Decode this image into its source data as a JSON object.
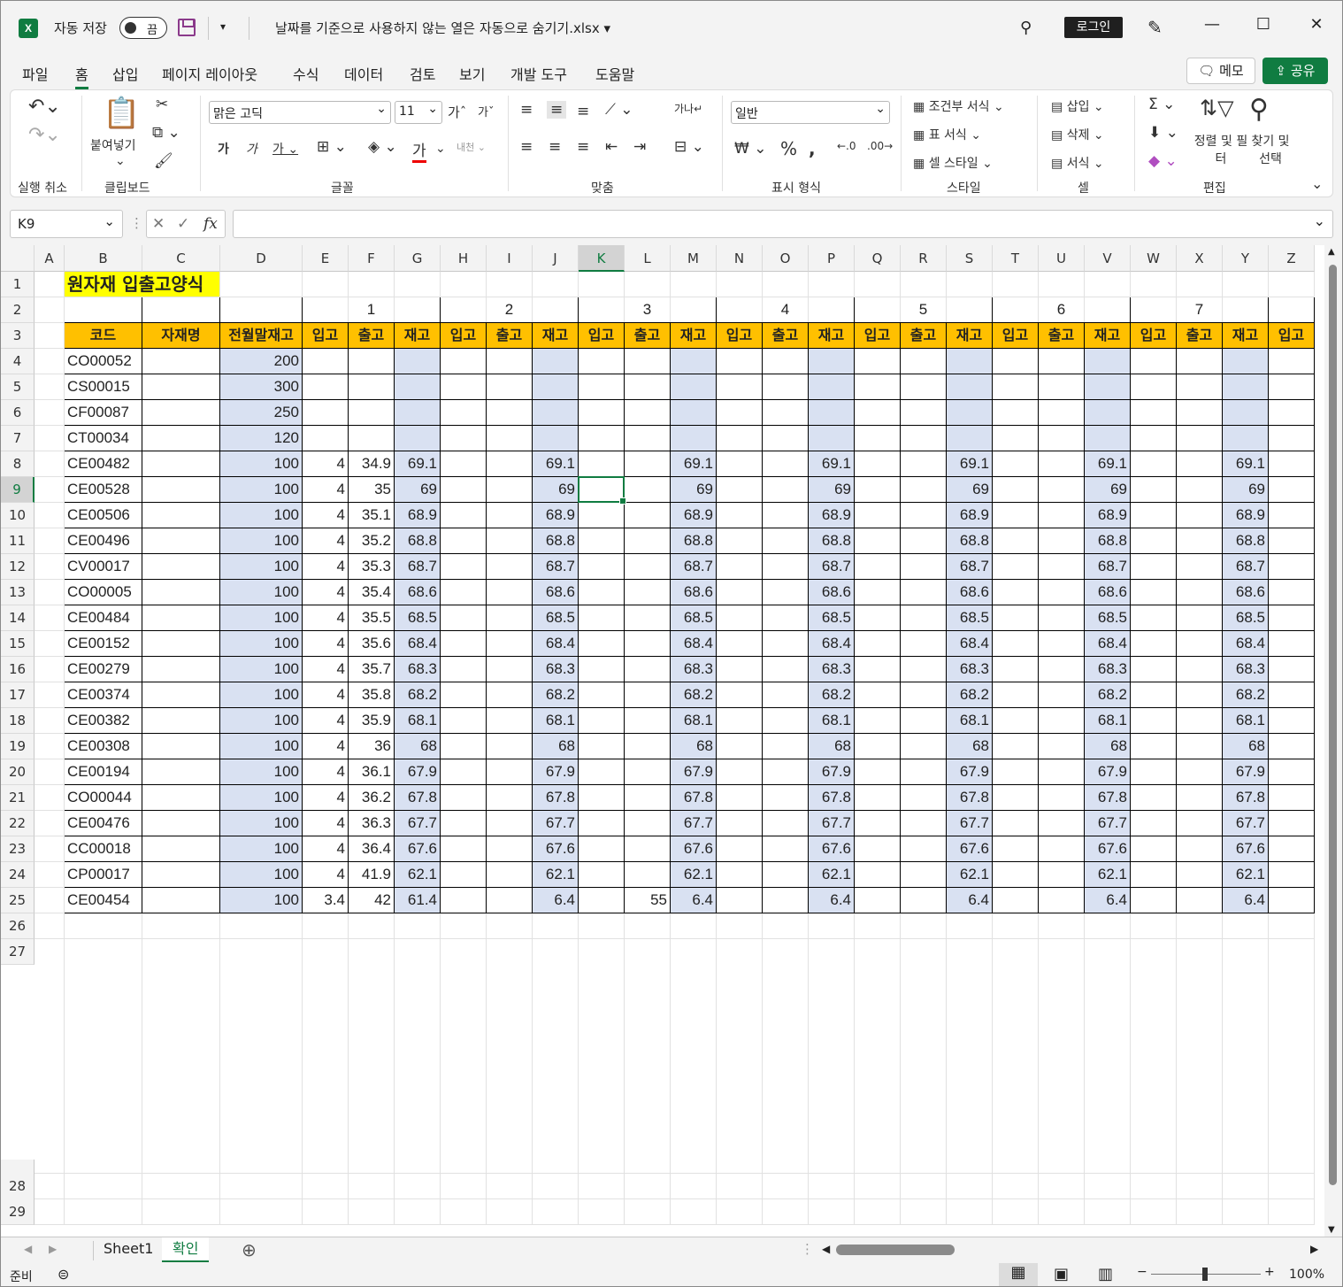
{
  "title_bar": {
    "app_icon": "excel-icon",
    "autosave_label": "자동 저장",
    "autosave_state": "끔",
    "document_title": "날짜를 기준으로 사용하지 않는 열은 자동으로 숨기기.xlsx",
    "login_label": "로그인"
  },
  "menu": {
    "items": [
      "파일",
      "홈",
      "삽입",
      "페이지 레이아웃",
      "수식",
      "데이터",
      "검토",
      "보기",
      "개발 도구",
      "도움말"
    ],
    "active": "홈",
    "memo_label": "메모",
    "share_label": "공유"
  },
  "ribbon": {
    "groups": [
      "실행 취소",
      "클립보드",
      "글꼴",
      "맞춤",
      "표시 형식",
      "스타일",
      "셀",
      "편집"
    ],
    "paste_label": "붙여넣기",
    "font_name": "맑은 고딕",
    "font_size": "11",
    "number_format": "일반",
    "styles": [
      "조건부 서식",
      "표 서식",
      "셀 스타일"
    ],
    "cells": [
      "삽입",
      "삭제",
      "서식"
    ],
    "editing": [
      "정렬 및 필터",
      "찾기 및 선택"
    ]
  },
  "formula_bar": {
    "name_box": "K9",
    "formula": ""
  },
  "sheet": {
    "columns": [
      "A",
      "B",
      "C",
      "D",
      "E",
      "F",
      "G",
      "H",
      "I",
      "J",
      "K",
      "L",
      "M",
      "N",
      "O",
      "P",
      "Q",
      "R",
      "S",
      "T",
      "U",
      "V",
      "W",
      "X",
      "Y",
      "Z"
    ],
    "selected_cell": "K9",
    "title": "원자재 입출고양식",
    "day_numbers": [
      "1",
      "2",
      "3",
      "4",
      "5",
      "6",
      "7"
    ],
    "headers": [
      "코드",
      "자재명",
      "전월말재고"
    ],
    "sub_headers": [
      "입고",
      "출고",
      "재고"
    ],
    "rows": [
      {
        "code": "CO00052",
        "stock": "200",
        "in": "",
        "out": "",
        "bal": "",
        "d3in": "",
        "d3bal": ""
      },
      {
        "code": "CS00015",
        "stock": "300",
        "in": "",
        "out": "",
        "bal": "",
        "d3in": "",
        "d3bal": ""
      },
      {
        "code": "CF00087",
        "stock": "250",
        "in": "",
        "out": "",
        "bal": "",
        "d3in": "",
        "d3bal": ""
      },
      {
        "code": "CT00034",
        "stock": "120",
        "in": "",
        "out": "",
        "bal": "",
        "d3in": "",
        "d3bal": ""
      },
      {
        "code": "CE00482",
        "stock": "100",
        "in": "4",
        "out": "34.9",
        "bal": "69.1",
        "d3in": "",
        "d3bal": "69.1"
      },
      {
        "code": "CE00528",
        "stock": "100",
        "in": "4",
        "out": "35",
        "bal": "69",
        "d3in": "",
        "d3bal": "69"
      },
      {
        "code": "CE00506",
        "stock": "100",
        "in": "4",
        "out": "35.1",
        "bal": "68.9",
        "d3in": "",
        "d3bal": "68.9"
      },
      {
        "code": "CE00496",
        "stock": "100",
        "in": "4",
        "out": "35.2",
        "bal": "68.8",
        "d3in": "",
        "d3bal": "68.8"
      },
      {
        "code": "CV00017",
        "stock": "100",
        "in": "4",
        "out": "35.3",
        "bal": "68.7",
        "d3in": "",
        "d3bal": "68.7"
      },
      {
        "code": "CO00005",
        "stock": "100",
        "in": "4",
        "out": "35.4",
        "bal": "68.6",
        "d3in": "",
        "d3bal": "68.6"
      },
      {
        "code": "CE00484",
        "stock": "100",
        "in": "4",
        "out": "35.5",
        "bal": "68.5",
        "d3in": "",
        "d3bal": "68.5"
      },
      {
        "code": "CE00152",
        "stock": "100",
        "in": "4",
        "out": "35.6",
        "bal": "68.4",
        "d3in": "",
        "d3bal": "68.4"
      },
      {
        "code": "CE00279",
        "stock": "100",
        "in": "4",
        "out": "35.7",
        "bal": "68.3",
        "d3in": "",
        "d3bal": "68.3"
      },
      {
        "code": "CE00374",
        "stock": "100",
        "in": "4",
        "out": "35.8",
        "bal": "68.2",
        "d3in": "",
        "d3bal": "68.2"
      },
      {
        "code": "CE00382",
        "stock": "100",
        "in": "4",
        "out": "35.9",
        "bal": "68.1",
        "d3in": "",
        "d3bal": "68.1"
      },
      {
        "code": "CE00308",
        "stock": "100",
        "in": "4",
        "out": "36",
        "bal": "68",
        "d3in": "",
        "d3bal": "68"
      },
      {
        "code": "CE00194",
        "stock": "100",
        "in": "4",
        "out": "36.1",
        "bal": "67.9",
        "d3in": "",
        "d3bal": "67.9"
      },
      {
        "code": "CO00044",
        "stock": "100",
        "in": "4",
        "out": "36.2",
        "bal": "67.8",
        "d3in": "",
        "d3bal": "67.8"
      },
      {
        "code": "CE00476",
        "stock": "100",
        "in": "4",
        "out": "36.3",
        "bal": "67.7",
        "d3in": "",
        "d3bal": "67.7"
      },
      {
        "code": "CC00018",
        "stock": "100",
        "in": "4",
        "out": "36.4",
        "bal": "67.6",
        "d3in": "",
        "d3bal": "67.6"
      },
      {
        "code": "CP00017",
        "stock": "100",
        "in": "4",
        "out": "41.9",
        "bal": "62.1",
        "d3in": "",
        "d3bal": "62.1"
      },
      {
        "code": "CE00454",
        "stock": "100",
        "in": "3.4",
        "out": "42",
        "bal": "61.4",
        "d3in": "55",
        "d3bal": "6.4"
      }
    ],
    "row_numbers": [
      "1",
      "2",
      "3",
      "4",
      "5",
      "6",
      "7",
      "8",
      "9",
      "10",
      "11",
      "12",
      "13",
      "14",
      "15",
      "16",
      "17",
      "18",
      "19",
      "20",
      "21",
      "22",
      "23",
      "24",
      "25",
      "26",
      "27",
      "28",
      "29"
    ]
  },
  "sheet_tabs": [
    "Sheet1",
    "확인"
  ],
  "active_tab": "확인",
  "status_bar": {
    "mode": "준비",
    "zoom": "100%"
  },
  "colors": {
    "accent": "#107c41",
    "header_fill": "#ffc000",
    "title_fill": "#ffff00",
    "stock_fill": "#d9e1f2"
  }
}
